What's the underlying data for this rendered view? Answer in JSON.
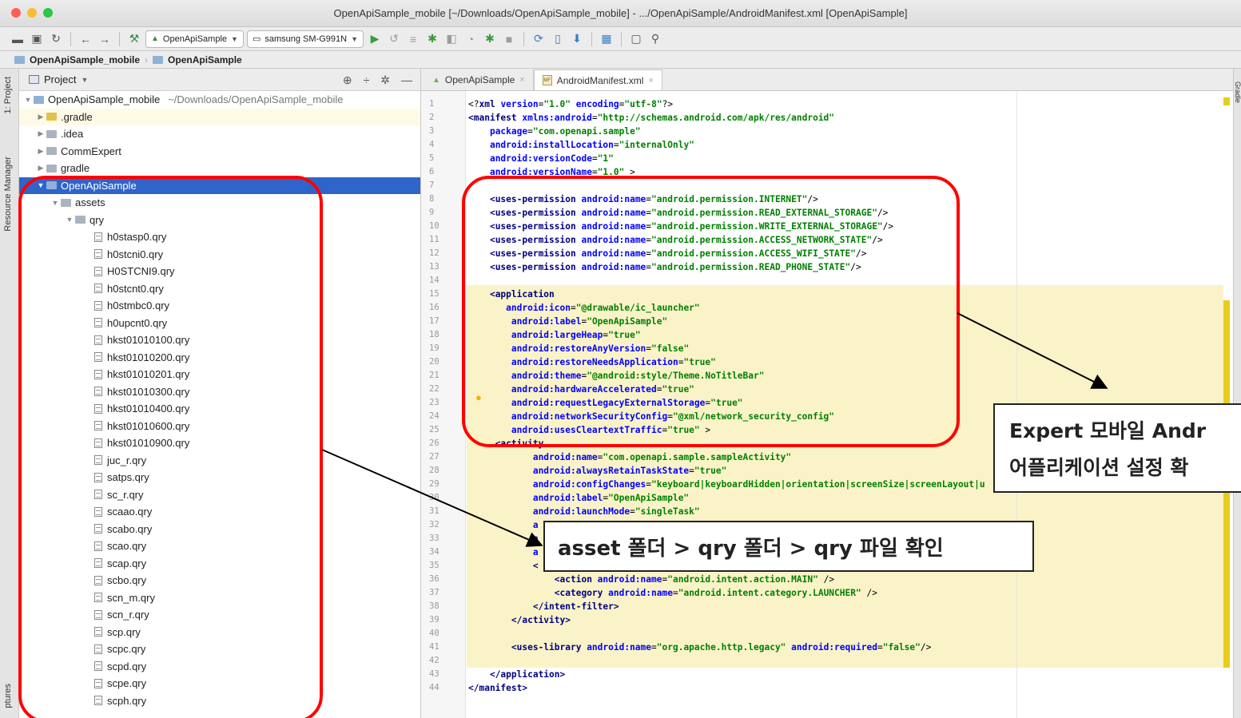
{
  "window": {
    "title": "OpenApiSample_mobile [~/Downloads/OpenApiSample_mobile] - .../OpenApiSample/AndroidManifest.xml [OpenApiSample]"
  },
  "toolbar": {
    "module_combo": "OpenApiSample",
    "device_combo": "samsung SM-G991N"
  },
  "breadcrumb": [
    "OpenApiSample_mobile",
    "OpenApiSample"
  ],
  "left_tabs": [
    "1: Project",
    "Resource Manager",
    "ptures"
  ],
  "right_tabs": [
    "Gradle"
  ],
  "project_panel": {
    "title": "Project",
    "root": {
      "name": "OpenApiSample_mobile",
      "path": "~/Downloads/OpenApiSample_mobile"
    },
    "top_items": [
      ".gradle",
      ".idea",
      "CommExpert",
      "gradle",
      "OpenApiSample"
    ],
    "assets": "assets",
    "qry_folder": "qry",
    "files": [
      "h0stasp0.qry",
      "h0stcni0.qry",
      "H0STCNI9.qry",
      "h0stcnt0.qry",
      "h0stmbc0.qry",
      "h0upcnt0.qry",
      "hkst01010100.qry",
      "hkst01010200.qry",
      "hkst01010201.qry",
      "hkst01010300.qry",
      "hkst01010400.qry",
      "hkst01010600.qry",
      "hkst01010900.qry",
      "juc_r.qry",
      "satps.qry",
      "sc_r.qry",
      "scaao.qry",
      "scabo.qry",
      "scao.qry",
      "scap.qry",
      "scbo.qry",
      "scn_m.qry",
      "scn_r.qry",
      "scp.qry",
      "scpc.qry",
      "scpd.qry",
      "scpe.qry",
      "scph.qry"
    ]
  },
  "editor": {
    "tabs": [
      "OpenApiSample",
      "AndroidManifest.xml"
    ],
    "lines": [
      [
        [
          "p",
          "<?"
        ],
        [
          "t",
          "xml "
        ],
        [
          "a",
          "version"
        ],
        [
          "p",
          "="
        ],
        [
          "v",
          "\"1.0\""
        ],
        [
          "p",
          " "
        ],
        [
          "a",
          "encoding"
        ],
        [
          "p",
          "="
        ],
        [
          "v",
          "\"utf-8\""
        ],
        [
          "p",
          "?>"
        ]
      ],
      [
        [
          "t",
          "<manifest "
        ],
        [
          "a",
          "xmlns:android"
        ],
        [
          "p",
          "="
        ],
        [
          "v",
          "\"http://schemas.android.com/apk/res/android\""
        ]
      ],
      [
        [
          "p",
          "    "
        ],
        [
          "a",
          "package"
        ],
        [
          "p",
          "="
        ],
        [
          "v",
          "\"com.openapi.sample\""
        ]
      ],
      [
        [
          "p",
          "    "
        ],
        [
          "a",
          "android:installLocation"
        ],
        [
          "p",
          "="
        ],
        [
          "v",
          "\"internalOnly\""
        ]
      ],
      [
        [
          "p",
          "    "
        ],
        [
          "a",
          "android:versionCode"
        ],
        [
          "p",
          "="
        ],
        [
          "v",
          "\"1\""
        ]
      ],
      [
        [
          "p",
          "    "
        ],
        [
          "a",
          "android:versionName"
        ],
        [
          "p",
          "="
        ],
        [
          "v",
          "\"1.0\""
        ],
        [
          "p",
          " >"
        ]
      ],
      [],
      [
        [
          "p",
          "    "
        ],
        [
          "t",
          "<uses-permission "
        ],
        [
          "a",
          "android:name"
        ],
        [
          "p",
          "="
        ],
        [
          "v",
          "\"android.permission.INTERNET\""
        ],
        [
          "p",
          "/>"
        ]
      ],
      [
        [
          "p",
          "    "
        ],
        [
          "t",
          "<uses-permission "
        ],
        [
          "a",
          "android:name"
        ],
        [
          "p",
          "="
        ],
        [
          "v",
          "\"android.permission.READ_EXTERNAL_STORAGE\""
        ],
        [
          "p",
          "/>"
        ]
      ],
      [
        [
          "p",
          "    "
        ],
        [
          "t",
          "<uses-permission "
        ],
        [
          "a",
          "android:name"
        ],
        [
          "p",
          "="
        ],
        [
          "v",
          "\"android.permission.WRITE_EXTERNAL_STORAGE\""
        ],
        [
          "p",
          "/>"
        ]
      ],
      [
        [
          "p",
          "    "
        ],
        [
          "t",
          "<uses-permission "
        ],
        [
          "a",
          "android:name"
        ],
        [
          "p",
          "="
        ],
        [
          "v",
          "\"android.permission.ACCESS_NETWORK_STATE\""
        ],
        [
          "p",
          "/>"
        ]
      ],
      [
        [
          "p",
          "    "
        ],
        [
          "t",
          "<uses-permission "
        ],
        [
          "a",
          "android:name"
        ],
        [
          "p",
          "="
        ],
        [
          "v",
          "\"android.permission.ACCESS_WIFI_STATE\""
        ],
        [
          "p",
          "/>"
        ]
      ],
      [
        [
          "p",
          "    "
        ],
        [
          "t",
          "<uses-permission "
        ],
        [
          "a",
          "android:name"
        ],
        [
          "p",
          "="
        ],
        [
          "v",
          "\"android.permission.READ_PHONE_STATE\""
        ],
        [
          "p",
          "/>"
        ]
      ],
      [],
      [
        [
          "p",
          "    "
        ],
        [
          "t",
          "<application"
        ]
      ],
      [
        [
          "p",
          "       "
        ],
        [
          "a",
          "android:icon"
        ],
        [
          "p",
          "="
        ],
        [
          "v",
          "\"@drawable/ic_launcher\""
        ]
      ],
      [
        [
          "p",
          "        "
        ],
        [
          "a",
          "android:label"
        ],
        [
          "p",
          "="
        ],
        [
          "v",
          "\"OpenApiSample\""
        ]
      ],
      [
        [
          "p",
          "        "
        ],
        [
          "a",
          "android:largeHeap"
        ],
        [
          "p",
          "="
        ],
        [
          "v",
          "\"true\""
        ]
      ],
      [
        [
          "p",
          "        "
        ],
        [
          "a",
          "android:restoreAnyVersion"
        ],
        [
          "p",
          "="
        ],
        [
          "v",
          "\"false\""
        ]
      ],
      [
        [
          "p",
          "        "
        ],
        [
          "a",
          "android:restoreNeedsApplication"
        ],
        [
          "p",
          "="
        ],
        [
          "v",
          "\"true\""
        ]
      ],
      [
        [
          "p",
          "        "
        ],
        [
          "a",
          "android:theme"
        ],
        [
          "p",
          "="
        ],
        [
          "v",
          "\"@android:style/Theme.NoTitleBar\""
        ]
      ],
      [
        [
          "p",
          "        "
        ],
        [
          "a",
          "android:hardwareAccelerated"
        ],
        [
          "p",
          "="
        ],
        [
          "v",
          "\"true\""
        ]
      ],
      [
        [
          "p",
          "        "
        ],
        [
          "a",
          "android:requestLegacyExternalStorage"
        ],
        [
          "p",
          "="
        ],
        [
          "v",
          "\"true\""
        ]
      ],
      [
        [
          "p",
          "        "
        ],
        [
          "a",
          "android:networkSecurityConfig"
        ],
        [
          "p",
          "="
        ],
        [
          "v",
          "\"@xml/network_security_config\""
        ]
      ],
      [
        [
          "p",
          "        "
        ],
        [
          "a",
          "android:usesCleartextTraffic"
        ],
        [
          "p",
          "="
        ],
        [
          "v",
          "\"true\""
        ],
        [
          "p",
          " >"
        ]
      ],
      [
        [
          "p",
          "     "
        ],
        [
          "t",
          "<activity"
        ]
      ],
      [
        [
          "p",
          "            "
        ],
        [
          "a",
          "android:name"
        ],
        [
          "p",
          "="
        ],
        [
          "v",
          "\"com.openapi.sample.sampleActivity\""
        ]
      ],
      [
        [
          "p",
          "            "
        ],
        [
          "a",
          "android:alwaysRetainTaskState"
        ],
        [
          "p",
          "="
        ],
        [
          "v",
          "\"true\""
        ]
      ],
      [
        [
          "p",
          "            "
        ],
        [
          "a",
          "android:configChanges"
        ],
        [
          "p",
          "="
        ],
        [
          "v",
          "\"keyboard|keyboardHidden|orientation|screenSize|screenLayout|u"
        ]
      ],
      [
        [
          "p",
          "            "
        ],
        [
          "a",
          "android:label"
        ],
        [
          "p",
          "="
        ],
        [
          "v",
          "\"OpenApiSample\""
        ]
      ],
      [
        [
          "p",
          "            "
        ],
        [
          "a",
          "android:launchMode"
        ],
        [
          "p",
          "="
        ],
        [
          "v",
          "\"singleTask\""
        ]
      ],
      [
        [
          "p",
          "            "
        ],
        [
          "a",
          "a"
        ]
      ],
      [
        [
          "p",
          "            "
        ],
        [
          "a",
          "a"
        ]
      ],
      [
        [
          "p",
          "            "
        ],
        [
          "a",
          "a"
        ]
      ],
      [
        [
          "p",
          "            "
        ],
        [
          "t",
          "<"
        ]
      ],
      [
        [
          "p",
          "                "
        ],
        [
          "t",
          "<action "
        ],
        [
          "a",
          "android:name"
        ],
        [
          "p",
          "="
        ],
        [
          "v",
          "\"android.intent.action.MAIN\""
        ],
        [
          "p",
          " />"
        ]
      ],
      [
        [
          "p",
          "                "
        ],
        [
          "t",
          "<category "
        ],
        [
          "a",
          "android:name"
        ],
        [
          "p",
          "="
        ],
        [
          "v",
          "\"android.intent.category.LAUNCHER\""
        ],
        [
          "p",
          " />"
        ]
      ],
      [
        [
          "p",
          "            "
        ],
        [
          "t",
          "</intent-filter>"
        ]
      ],
      [
        [
          "p",
          "        "
        ],
        [
          "t",
          "</activity>"
        ]
      ],
      [],
      [
        [
          "p",
          "        "
        ],
        [
          "t",
          "<uses-library "
        ],
        [
          "a",
          "android:name"
        ],
        [
          "p",
          "="
        ],
        [
          "v",
          "\"org.apache.http.legacy\""
        ],
        [
          "p",
          " "
        ],
        [
          "a",
          "android:required"
        ],
        [
          "p",
          "="
        ],
        [
          "v",
          "\"false\""
        ],
        [
          "p",
          "/>"
        ]
      ],
      [],
      [
        [
          "p",
          "    "
        ],
        [
          "t",
          "</application>"
        ]
      ],
      [
        [
          "t",
          "</manifest>"
        ]
      ]
    ]
  },
  "annotations": {
    "callout_left": "asset 폴더 > qry 폴더 > qry 파일 확인",
    "callout_right_line1": "Expert 모바일 Andr",
    "callout_right_line2": "어플리케이션 설정 확"
  },
  "colors": {
    "selection": "#2f65ca",
    "highlight_red": "#ff0000",
    "xml_tag": "#000080",
    "xml_attr": "#0000ff",
    "xml_value": "#008000"
  }
}
